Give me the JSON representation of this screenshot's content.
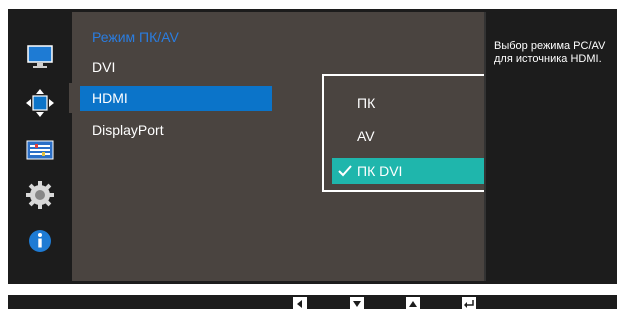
{
  "main": {
    "title": "Режим ПК/AV",
    "items": [
      {
        "label": "DVI",
        "selected": false
      },
      {
        "label": "HDMI",
        "selected": true
      },
      {
        "label": "DisplayPort",
        "selected": false
      }
    ]
  },
  "submenu": {
    "items": [
      {
        "label": "ПК",
        "checked": false
      },
      {
        "label": "AV",
        "checked": false
      },
      {
        "label": "ПК DVI",
        "checked": true
      }
    ]
  },
  "help": {
    "text": "Выбор режима PC/AV для источника HDMI."
  },
  "sidebar": {
    "icons": [
      "monitor-icon",
      "position-size-icon",
      "settings-bars-icon",
      "gear-icon",
      "info-icon"
    ],
    "selected_index": 1
  },
  "keybar": {
    "keys": [
      "left-key-icon",
      "down-key-icon",
      "up-key-icon",
      "enter-key-icon"
    ]
  },
  "colors": {
    "accent_blue": "#0b74c9",
    "title_blue": "#2a7de0",
    "selected_teal": "#1fb6ac",
    "panel_bg": "#4a4440",
    "osd_bg": "#1c1c1c"
  }
}
